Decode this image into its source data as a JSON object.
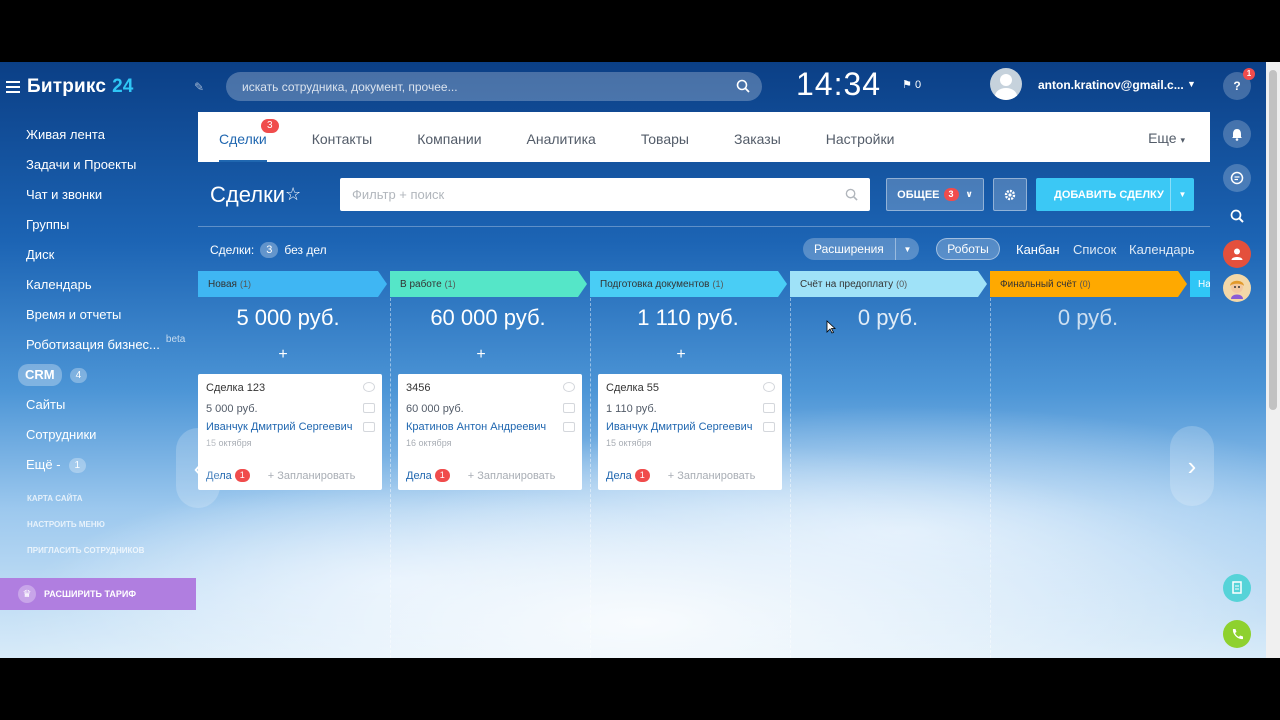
{
  "sidebar": {
    "logo_name": "Битрикс",
    "logo_num": "24",
    "items": [
      {
        "label": "Живая лента"
      },
      {
        "label": "Задачи и Проекты"
      },
      {
        "label": "Чат и звонки"
      },
      {
        "label": "Группы"
      },
      {
        "label": "Диск"
      },
      {
        "label": "Календарь"
      },
      {
        "label": "Время и отчеты"
      },
      {
        "label": "Роботизация бизнес...",
        "tag": "beta"
      },
      {
        "label": "CRM",
        "count": "4"
      },
      {
        "label": "Сайты"
      },
      {
        "label": "Сотрудники"
      },
      {
        "label": "Ещё -",
        "count": "1"
      }
    ],
    "small_links": [
      "КАРТА САЙТА",
      "НАСТРОИТЬ МЕНЮ",
      "ПРИГЛАСИТЬ СОТРУДНИКОВ"
    ],
    "upgrade_label": "РАСШИРИТЬ ТАРИФ"
  },
  "header": {
    "search_placeholder": "искать сотрудника, документ, прочее...",
    "clock": "14:34",
    "flag_count": "0",
    "user_email": "anton.kratinov@gmail.c...",
    "help_badge": "1"
  },
  "tabs": {
    "items": [
      {
        "label": "Сделки",
        "badge": "3"
      },
      {
        "label": "Контакты"
      },
      {
        "label": "Компании"
      },
      {
        "label": "Аналитика"
      },
      {
        "label": "Товары"
      },
      {
        "label": "Заказы"
      },
      {
        "label": "Настройки"
      }
    ],
    "more": "Еще"
  },
  "page": {
    "title": "Сделки",
    "filter_placeholder": "Фильтр + поиск",
    "general_label": "ОБЩЕЕ",
    "general_badge": "3",
    "add_label": "ДОБАВИТЬ СДЕЛКУ",
    "deals_label": "Сделки:",
    "deals_count": "3",
    "no_tasks": "без дел",
    "extensions": "Расширения",
    "robots": "Роботы",
    "views": [
      "Канбан",
      "Список",
      "Календарь"
    ]
  },
  "kanban": {
    "stages": [
      {
        "name": "Новая",
        "count": "(1)",
        "sum": "5 000 руб.",
        "color": "#3fb6f3"
      },
      {
        "name": "В работе",
        "count": "(1)",
        "sum": "60 000 руб.",
        "color": "#55e6c8"
      },
      {
        "name": "Подготовка документов",
        "count": "(1)",
        "sum": "1 110 руб.",
        "color": "#49cdf5"
      },
      {
        "name": "Счёт на предоплату",
        "count": "(0)",
        "sum": "0 руб.",
        "color": "#9fe2f8"
      },
      {
        "name": "Финальный счёт",
        "count": "(0)",
        "sum": "0 руб.",
        "color": "#ffa900"
      },
      {
        "name": "На",
        "color": "#2fc6f6"
      }
    ],
    "cards": [
      {
        "title": "Сделка 123",
        "sum": "5 000 руб.",
        "contact": "Иванчук Дмитрий Сергеевич",
        "date": "15 октября",
        "activity": "Дела",
        "activity_count": "1",
        "plan": "+ Запланировать"
      },
      {
        "title": "3456",
        "sum": "60 000 руб.",
        "contact": "Кратинов Антон Андреевич",
        "date": "16 октября",
        "activity": "Дела",
        "activity_count": "1",
        "plan": "+ Запланировать"
      },
      {
        "title": "Сделка 55",
        "sum": "1 110 руб.",
        "contact": "Иванчук Дмитрий Сергеевич",
        "date": "15 октября",
        "activity": "Дела",
        "activity_count": "1",
        "plan": "+ Запланировать"
      }
    ]
  }
}
